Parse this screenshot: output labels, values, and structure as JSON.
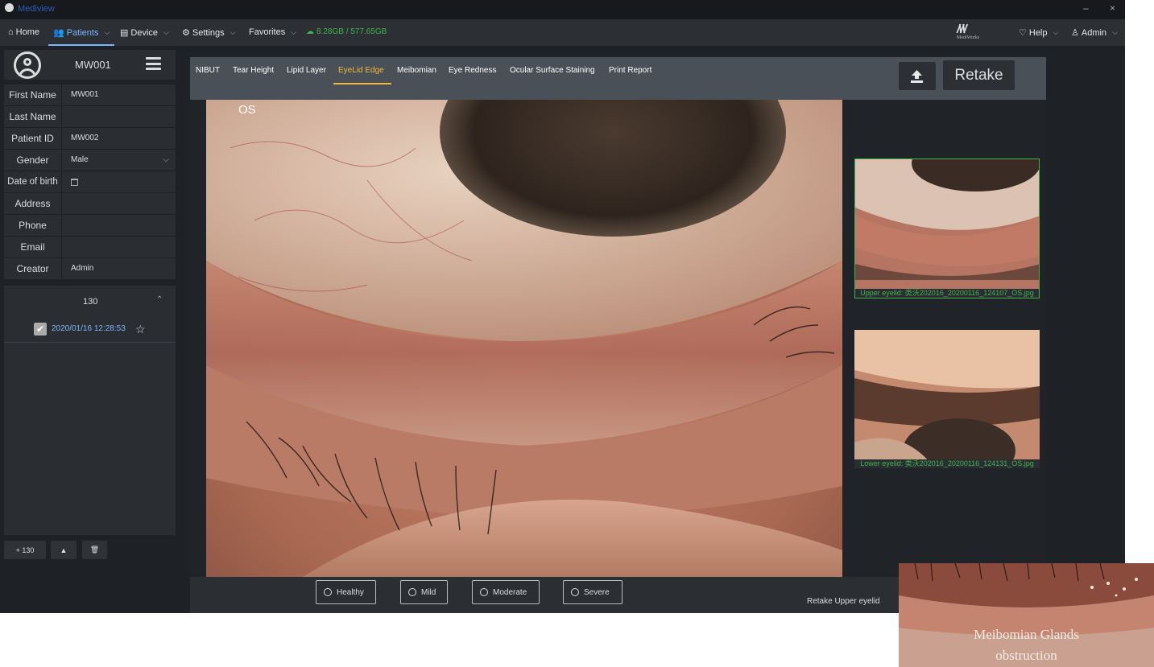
{
  "window": {
    "title": "Mediview",
    "minimize_glyph": "–",
    "close_glyph": "×"
  },
  "menu": {
    "home": "Home",
    "patients": "Patients",
    "device": "Device",
    "settings": "Settings",
    "favorites": "Favorites",
    "storage": "8.28GB / 577.65GB",
    "brand": "MediWorks",
    "help": "Help",
    "admin": "Admin"
  },
  "patient": {
    "header_id": "MW001",
    "fields": [
      {
        "label": "First Name",
        "value": "MW001"
      },
      {
        "label": "Last Name",
        "value": ""
      },
      {
        "label": "Patient ID",
        "value": "MW002"
      },
      {
        "label": "Gender",
        "value": "Male"
      },
      {
        "label": "Date of birth",
        "value": ""
      },
      {
        "label": "Address",
        "value": ""
      },
      {
        "label": "Phone",
        "value": ""
      },
      {
        "label": "Email",
        "value": ""
      },
      {
        "label": "Creator",
        "value": "Admin"
      }
    ],
    "visit": {
      "number": "130",
      "date": "2020/01/16 12:28:53"
    },
    "add_label": "+ 130"
  },
  "tabs": [
    "NIBUT",
    "Tear Height",
    "Lipid Layer",
    "EyeLid Edge",
    "Meibomian",
    "Eye Redness",
    "Ocular Surface Staining",
    "Print Report"
  ],
  "active_tab": "EyeLid Edge",
  "retake_label": "Retake",
  "eye_label": "OS",
  "thumbnails": [
    {
      "caption": "Upper eyelid: 类沃202016_20200116_124107_OS.jpg"
    },
    {
      "caption": "Lower eyelid: 类沃202016_20200116_124131_OS.jpg"
    }
  ],
  "grades": [
    "Healthy",
    "Mild",
    "Moderate",
    "Severe"
  ],
  "retake_upper_label": "Retake Upper eyelid",
  "inset_caption_line1": "Meibomian Glands",
  "inset_caption_line2": "obstruction",
  "colors": {
    "accent_active_tab": "#f4b63a",
    "accent_menu": "#7fb2ff",
    "storage_green": "#3fb24a"
  }
}
